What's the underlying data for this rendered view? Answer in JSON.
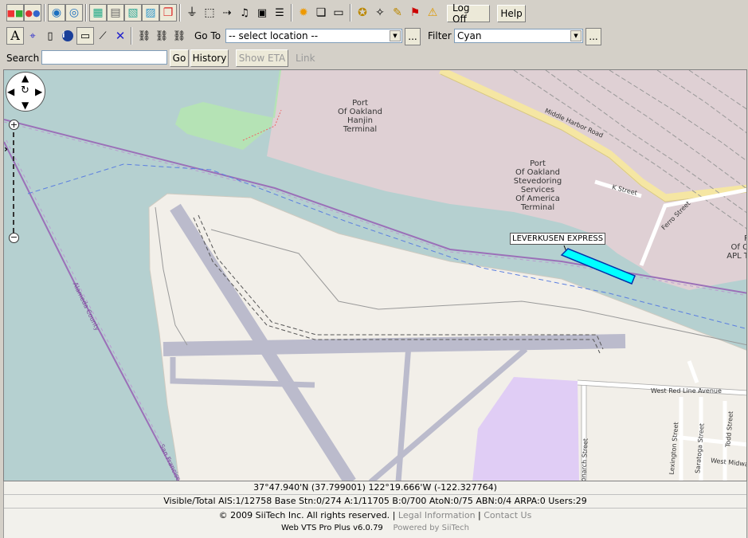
{
  "toolbar1": {
    "log_off_label": "Log Off",
    "help_label": "Help"
  },
  "toolbar2": {
    "text_tool_label": "A",
    "goto_label": "Go To",
    "goto_value": "-- select location --",
    "goto_more": "...",
    "filter_label": "Filter",
    "filter_value": "Cyan",
    "filter_more": "..."
  },
  "toolbar3": {
    "search_label": "Search",
    "search_value": "",
    "go_label": "Go",
    "history_label": "History",
    "show_eta_label": "Show ETA",
    "link_label": "Link"
  },
  "map": {
    "labels": {
      "hanjin": "Port\nOf Oakland\nHanjin\nTerminal",
      "ssa": "Port\nOf Oakland\nStevedoring\nServices\nOf America\nTerminal",
      "apl": "P\nOf O\nAPL T",
      "middle_harbor": "Middle Harbor Road",
      "k_street": "K Street",
      "ferro": "Ferro Street",
      "west_red_line": "West Red Line Avenue",
      "lexington": "Lexington Street",
      "saratoga": "Saratoga Street",
      "todd": "Todd Street",
      "west_midway": "West Midway",
      "monarch": "Monarch Street",
      "alameda_county": "Alameda County",
      "san_francisco": "San Francisco"
    },
    "vessel": {
      "name": "LEVERKUSEN EXPRESS",
      "color": "#00ffff"
    }
  },
  "status": {
    "coords": "37°47.940'N (37.799001)   122°19.666'W (-122.327764)",
    "stats": "Visible/Total AIS:1/12758  Base Stn:0/274  A:1/11705  B:0/700  AtoN:0/75  ABN:0/4  ARPA:0  Users:29",
    "copyright": "© 2009 SiiTech Inc. All rights reserved.",
    "legal": "Legal Information",
    "contact": "Contact Us",
    "version": "Web VTS Pro Plus v6.0.79",
    "powered": "Powered by SiiTech"
  },
  "colors": {
    "water": "#b5d0d0",
    "land": "#f2efe9",
    "port": "#dfd0d4",
    "runway": "#bbbbcc",
    "park": "#b5e3b5",
    "restricted": "#e0cdf5"
  }
}
